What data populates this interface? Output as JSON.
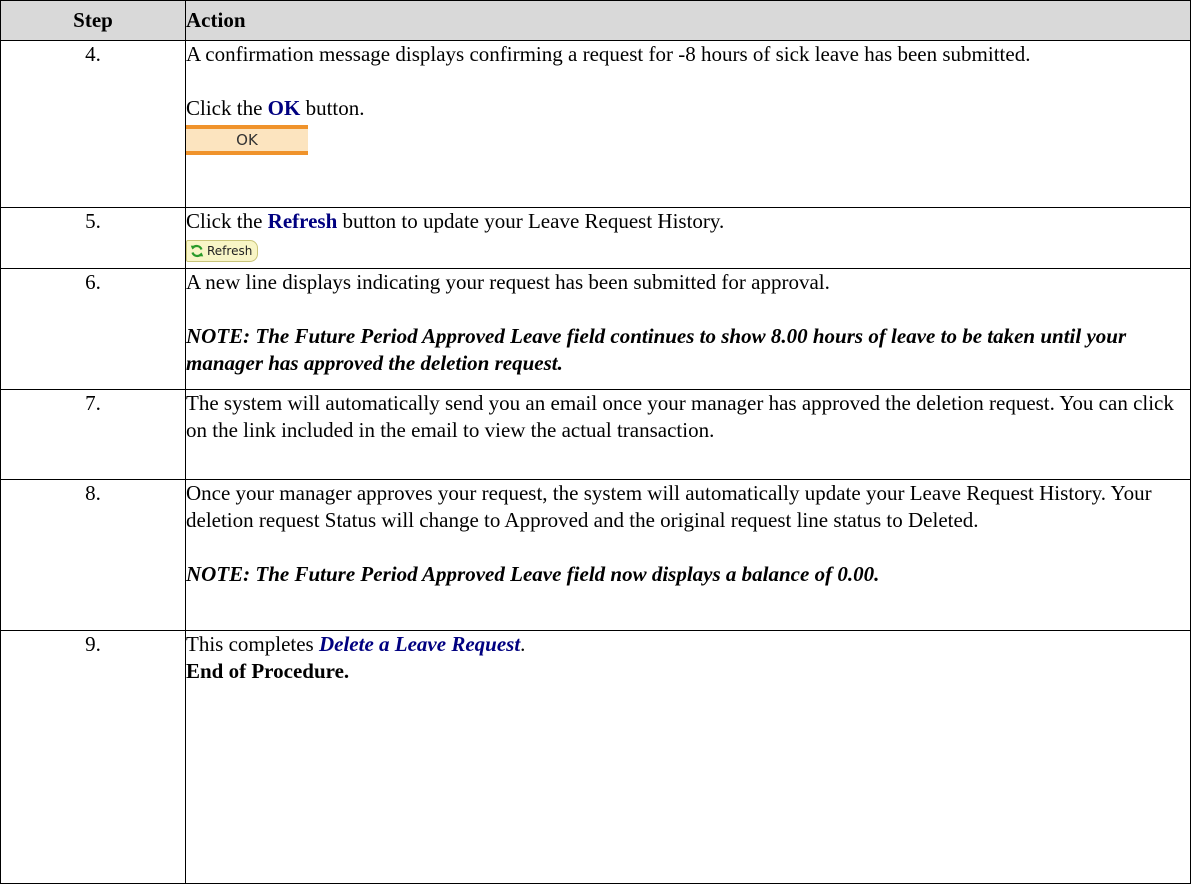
{
  "header": {
    "step": "Step",
    "action": "Action"
  },
  "rows": [
    {
      "step": "4.",
      "text": "A confirmation message displays confirming a request for -8 hours of sick leave has been submitted.",
      "click_pre": "Click the ",
      "click_hl": "OK",
      "click_post": " button.",
      "button_label": "OK"
    },
    {
      "step": "5.",
      "pre": "Click the ",
      "hl": "Refresh",
      "post": " button to update your Leave Request History.",
      "button_label": "Refresh"
    },
    {
      "step": "6.",
      "text": "A new line displays indicating your request has been submitted for approval.",
      "note": "NOTE:  The Future Period Approved Leave field continues to show 8.00 hours of leave to be taken until your manager has approved the deletion request."
    },
    {
      "step": "7.",
      "text": "The system will automatically send you an email once your manager has approved the deletion request.  You can click on the link included in the email to view the actual transaction."
    },
    {
      "step": "8.",
      "text": "Once your manager approves your request, the system will automatically update your Leave Request History.  Your deletion request Status will change to Approved and the original request line status to Deleted.",
      "note": "NOTE:  The Future Period Approved Leave field now displays a balance of 0.00."
    },
    {
      "step": "9.",
      "pre": "This completes ",
      "title": "Delete a Leave Request",
      "post": ".",
      "end": "End of Procedure."
    }
  ],
  "icons": {
    "refresh": "refresh-icon"
  },
  "colors": {
    "header_bg": "#d9d9d9",
    "highlight": "#000080",
    "ok_border": "#f0932b",
    "ok_fill": "#fce4bf",
    "refresh_fill": "#f8f5c6"
  }
}
